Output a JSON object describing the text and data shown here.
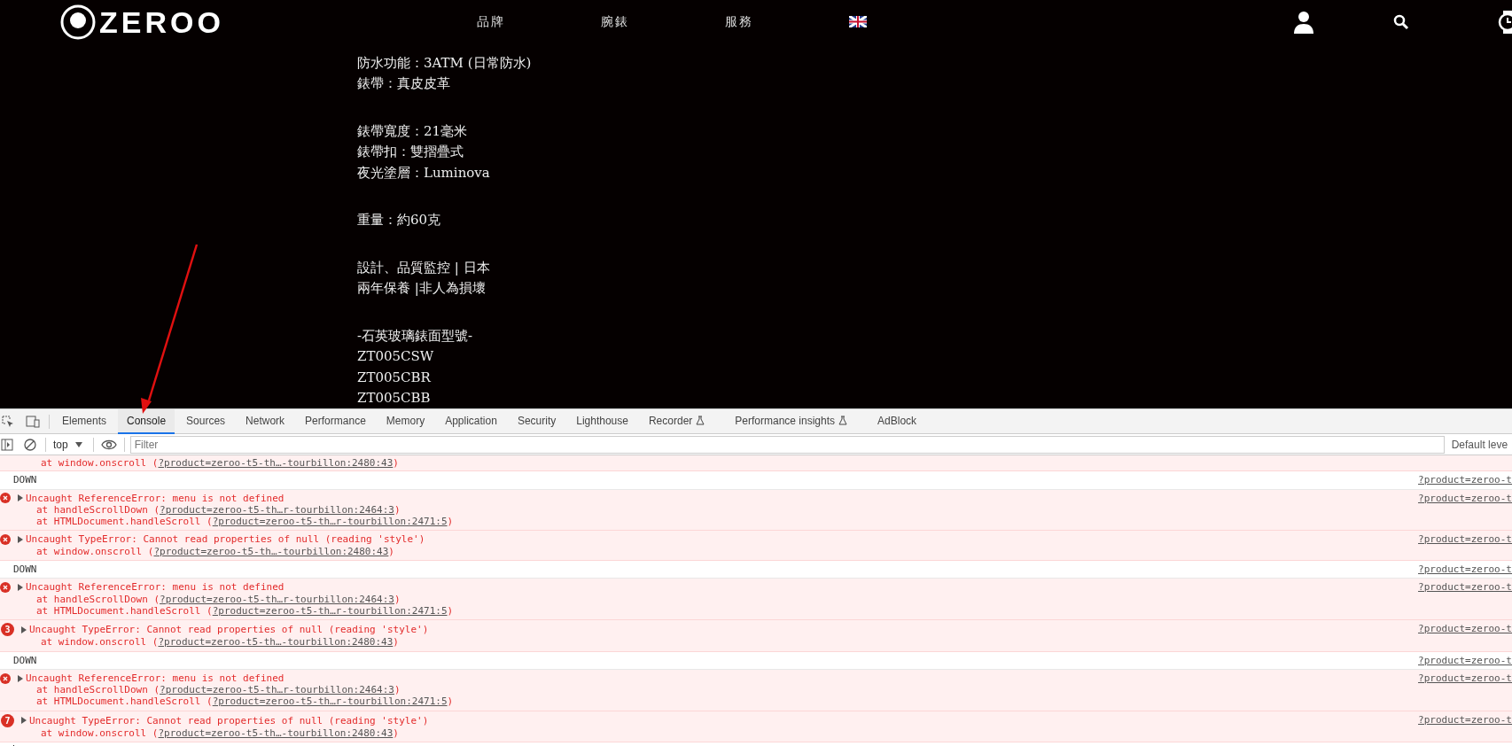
{
  "header": {
    "logo": "ZEROO",
    "nav": [
      "品牌",
      "腕錶",
      "服務"
    ]
  },
  "product_details": {
    "paragraphs": [
      [
        "防水功能：3ATM (日常防水)",
        "錶帶：真皮皮革"
      ],
      [
        "錶帶寬度：21毫米",
        "錶帶扣：雙摺疊式",
        "夜光塗層：Luminova"
      ],
      [
        "重量：約60克"
      ],
      [
        "設計、品質監控 | 日本",
        "兩年保養 |非人為損壞"
      ],
      [
        "-石英玻璃錶面型號-",
        "ZT005CSW",
        "ZT005CBR",
        "ZT005CBB"
      ]
    ]
  },
  "devtools": {
    "tabs": [
      {
        "label": "Elements",
        "selected": false,
        "experimental": false
      },
      {
        "label": "Console",
        "selected": true,
        "experimental": false
      },
      {
        "label": "Sources",
        "selected": false,
        "experimental": false
      },
      {
        "label": "Network",
        "selected": false,
        "experimental": false
      },
      {
        "label": "Performance",
        "selected": false,
        "experimental": false
      },
      {
        "label": "Memory",
        "selected": false,
        "experimental": false
      },
      {
        "label": "Application",
        "selected": false,
        "experimental": false
      },
      {
        "label": "Security",
        "selected": false,
        "experimental": false
      },
      {
        "label": "Lighthouse",
        "selected": false,
        "experimental": false
      },
      {
        "label": "Recorder",
        "selected": false,
        "experimental": true
      },
      {
        "label": "Performance insights",
        "selected": false,
        "experimental": true
      },
      {
        "label": "AdBlock",
        "selected": false,
        "experimental": false
      }
    ],
    "toolbar": {
      "context": "top",
      "filter_placeholder": "Filter",
      "levels": "Default leve"
    },
    "console": [
      {
        "kind": "trace",
        "stack": [
          {
            "prefix": "at window.onscroll (",
            "link": "?product=zeroo-t5-th…-tourbillon:2480:43",
            "suffix": ")"
          }
        ]
      },
      {
        "kind": "log",
        "text": "DOWN",
        "source": "?product=zeroo-t"
      },
      {
        "kind": "error",
        "expanded": false,
        "text": "Uncaught ReferenceError: menu is not defined",
        "source": "?product=zeroo-t",
        "stack": [
          {
            "prefix": "at handleScrollDown (",
            "link": "?product=zeroo-t5-th…r-tourbillon:2464:3",
            "suffix": ")"
          },
          {
            "prefix": "at HTMLDocument.handleScroll (",
            "link": "?product=zeroo-t5-th…r-tourbillon:2471:5",
            "suffix": ")"
          }
        ]
      },
      {
        "kind": "error",
        "expanded": false,
        "text": "Uncaught TypeError: Cannot read properties of null (reading 'style')",
        "source": "?product=zeroo-t",
        "stack": [
          {
            "prefix": "at window.onscroll (",
            "link": "?product=zeroo-t5-th…-tourbillon:2480:43",
            "suffix": ")"
          }
        ]
      },
      {
        "kind": "log",
        "text": "DOWN",
        "source": "?product=zeroo-t"
      },
      {
        "kind": "error",
        "expanded": false,
        "text": "Uncaught ReferenceError: menu is not defined",
        "source": "?product=zeroo-t",
        "stack": [
          {
            "prefix": "at handleScrollDown (",
            "link": "?product=zeroo-t5-th…r-tourbillon:2464:3",
            "suffix": ")"
          },
          {
            "prefix": "at HTMLDocument.handleScroll (",
            "link": "?product=zeroo-t5-th…r-tourbillon:2471:5",
            "suffix": ")"
          }
        ]
      },
      {
        "kind": "error",
        "expanded": false,
        "count": "3",
        "text": "Uncaught TypeError: Cannot read properties of null (reading 'style')",
        "source": "?product=zeroo-t",
        "stack": [
          {
            "prefix": "at window.onscroll (",
            "link": "?product=zeroo-t5-th…-tourbillon:2480:43",
            "suffix": ")"
          }
        ]
      },
      {
        "kind": "log",
        "text": "DOWN",
        "source": "?product=zeroo-t"
      },
      {
        "kind": "error",
        "expanded": false,
        "text": "Uncaught ReferenceError: menu is not defined",
        "source": "?product=zeroo-t",
        "stack": [
          {
            "prefix": "at handleScrollDown (",
            "link": "?product=zeroo-t5-th…r-tourbillon:2464:3",
            "suffix": ")"
          },
          {
            "prefix": "at HTMLDocument.handleScroll (",
            "link": "?product=zeroo-t5-th…r-tourbillon:2471:5",
            "suffix": ")"
          }
        ]
      },
      {
        "kind": "error",
        "expanded": false,
        "count": "7",
        "text": "Uncaught TypeError: Cannot read properties of null (reading 'style')",
        "source": "?product=zeroo-t",
        "stack": [
          {
            "prefix": "at window.onscroll (",
            "link": "?product=zeroo-t5-th…-tourbillon:2480:43",
            "suffix": ")"
          }
        ]
      }
    ]
  }
}
